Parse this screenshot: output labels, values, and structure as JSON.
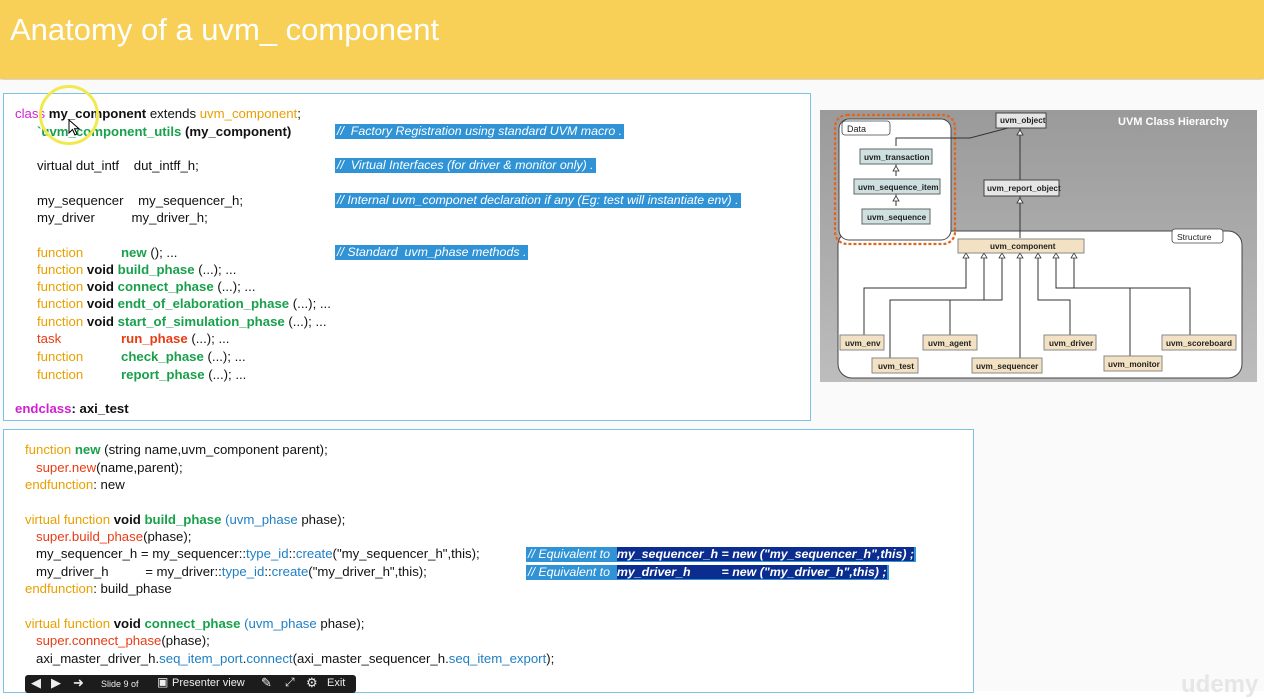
{
  "slide": {
    "title": "Anatomy of a uvm_ component"
  },
  "code_top": {
    "l1_kw": "class",
    "l1_name": "my_component",
    "l1_mid": " extends ",
    "l1_base": "uvm_component",
    "l1_end": ";",
    "l2_macro": "`uvm_component_utils",
    "l2_arg": " (my_component)",
    "l2_comment": "//  Factory Registration using standard UVM macro .",
    "l3": "virtual dut_intf    dut_intff_h;",
    "l3_comment": "//  Virtual Interfaces (for driver & monitor only) .",
    "l4": "my_sequencer    my_sequencer_h;",
    "l4_comment": "// Internal uvm_componet declaration if any (Eg: test will instantiate env) .",
    "l5": "my_driver          my_driver_h;",
    "fn_comment": "// Standard  uvm_phase methods .",
    "f1_kw": "function",
    "f1_name": "new",
    "f1_rest": " (); ...",
    "f2_kw": "function",
    "f2_void": " void ",
    "f2_name": "build_phase",
    "f2_rest": " (...); ...",
    "f3_kw": "function",
    "f3_void": " void ",
    "f3_name": "connect_phase",
    "f3_rest": " (...); ...",
    "f4_kw": "function",
    "f4_void": " void ",
    "f4_name": "endt_of_elaboration_phase",
    "f4_rest": " (...); ...",
    "f5_kw": "function",
    "f5_void": " void ",
    "f5_name": "start_of_simulation_phase",
    "f5_rest": " (...); ...",
    "f6_kw": "task",
    "f6_name": "run_phase",
    "f6_rest": " (...); ...",
    "f7_kw": "function",
    "f7_name": "check_phase",
    "f7_rest": " (...); ...",
    "f8_kw": "function",
    "f8_name": "report_phase",
    "f8_rest": " (...); ...",
    "end_kw": "endclass",
    "end_rest": ": axi_test"
  },
  "code_bottom": {
    "a1_kw": "function",
    "a1_name": " new",
    "a1_rest": " (string name,uvm_component parent);",
    "a2_kw": "super.new",
    "a2_rest": "(name,parent);",
    "a3_kw": "endfunction",
    "a3_rest": ": new",
    "b1_kw": "virtual function",
    "b1_void": " void ",
    "b1_name": "build_phase",
    "b1_type": " (uvm_phase",
    "b1_rest": " phase);",
    "b2_kw": "super.build_phase",
    "b2_rest": "(phase);",
    "b3_pre": "my_sequencer_h = my_sequencer::",
    "b3_tid": "type_id",
    "b3_mid": "::",
    "b3_cr": "create",
    "b3_rest": "(\"my_sequencer_h\",this);",
    "b3_c1": "// Equivalent to  ",
    "b3_c2": "my_sequencer_h = new (\"my_sequencer_h\",this) ;",
    "b4_pre": "my_driver_h          = my_driver::",
    "b4_tid": "type_id",
    "b4_mid": "::",
    "b4_cr": "create",
    "b4_rest": "(\"my_driver_h\",this);",
    "b4_c1": "// Equivalent to  ",
    "b4_c2": "my_driver_h         = new (\"my_driver_h\",this) ;",
    "b5_kw": "endfunction",
    "b5_rest": ": build_phase",
    "c1_kw": "virtual function",
    "c1_void": " void ",
    "c1_name": "connect_phase",
    "c1_type": " (uvm_phase",
    "c1_rest": " phase);",
    "c2_kw": "super.connect_phase",
    "c2_rest": "(phase);",
    "c3_pre": "axi_master_driver_h.",
    "c3_port": "seq_item_port",
    "c3_dot": ".",
    "c3_conn": "connect",
    "c3_arg": "(axi_master_sequencer_h.",
    "c3_exp": "seq_item_export",
    "c3_end": ");"
  },
  "diagram": {
    "title": "UVM Class Hierarchy",
    "data_label": "Data",
    "structure_label": "Structure",
    "nodes": {
      "uvm_object": "uvm_object",
      "uvm_transaction": "uvm_transaction",
      "uvm_sequence_item": "uvm_sequence_item",
      "uvm_sequence": "uvm_sequence",
      "uvm_report_object": "uvm_report_object",
      "uvm_component": "uvm_component",
      "uvm_env": "uvm_env",
      "uvm_test": "uvm_test",
      "uvm_agent": "uvm_agent",
      "uvm_sequencer": "uvm_sequencer",
      "uvm_driver": "uvm_driver",
      "uvm_monitor": "uvm_monitor",
      "uvm_scoreboard": "uvm_scoreboard"
    },
    "colors": {
      "data_node": "#cfe0e0",
      "struct_node": "#f2e2c3",
      "data_highlight": "#e0661f"
    }
  },
  "toolbar": {
    "slide_label": "Slide 9 of",
    "presenter": "Presenter view",
    "exit": "Exit"
  },
  "watermark": "udemy"
}
